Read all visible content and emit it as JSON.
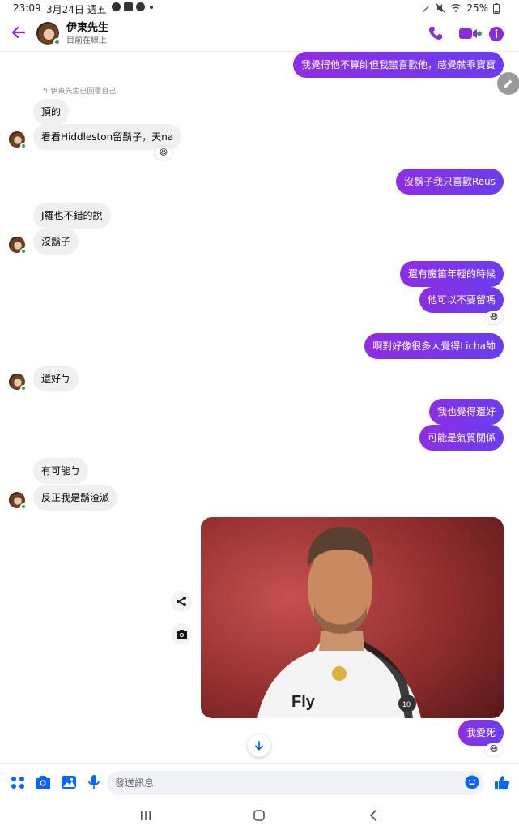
{
  "status_bar": {
    "time": "23:09",
    "date": "3月24日 週五",
    "battery": "25%"
  },
  "header": {
    "name": "伊東先生",
    "status": "目前在線上"
  },
  "colors": {
    "accent": "#8a2be2",
    "outgoing_start": "#8e2de2",
    "outgoing_end": "#6a3ef0",
    "incoming_bg": "#f0f0f0",
    "online": "#31a24c",
    "blue": "#0866ff"
  },
  "messages": {
    "m1": "我覺得他不算帥但我蠻喜歡他，感覺就乖寶寶",
    "reply_note": "伊東先生已回覆自己",
    "m2": "頂的",
    "m3": "看看Hiddleston留鬍子，天na",
    "m4": "沒鬍子我只喜歡Reus",
    "m5": "J羅也不錯的說",
    "m6": "沒鬍子",
    "m7": "還有魔笛年輕的時候",
    "m8": "他可以不要留嗎",
    "m9": "啊對好像很多人覺得Licha帥",
    "m10": "還好ㄅ",
    "m11": "我也覺得還好",
    "m12": "可能是氣質關係",
    "m13": "有可能ㄅ",
    "m14": "反正我是鬍渣派",
    "m15": "我愛死",
    "reaction": "😆"
  },
  "photo": {
    "jersey_text": "Fly",
    "badge_text": "10"
  },
  "composer": {
    "placeholder": "發送訊息"
  },
  "icons": [
    "back-arrow-icon",
    "phone-icon",
    "video-icon",
    "info-icon",
    "edit-icon",
    "share-icon",
    "camera-icon",
    "arrow-down-icon",
    "apps-icon",
    "image-icon",
    "microphone-icon",
    "emoji-icon",
    "like-icon",
    "recents-icon",
    "home-icon",
    "back-icon"
  ]
}
